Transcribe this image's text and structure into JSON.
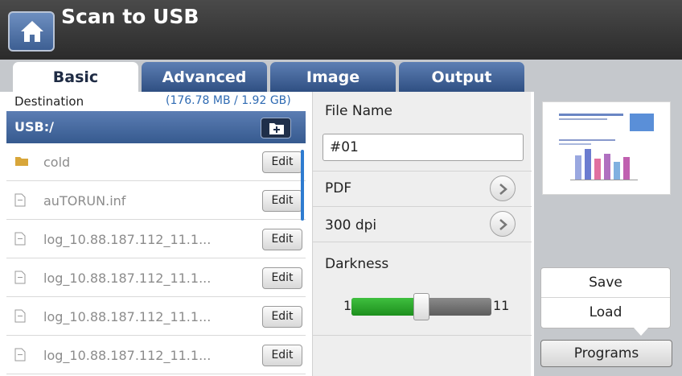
{
  "app": {
    "title": "Scan to USB"
  },
  "tabs": [
    {
      "label": "Basic",
      "active": true
    },
    {
      "label": "Advanced",
      "active": false
    },
    {
      "label": "Image",
      "active": false
    },
    {
      "label": "Output",
      "active": false
    }
  ],
  "destination": {
    "label": "Destination",
    "size": "(176.78 MB / 1.92 GB)",
    "path": "USB:/"
  },
  "files": [
    {
      "name": "cold",
      "type": "folder",
      "edit_label": "Edit"
    },
    {
      "name": "auTORUN.inf",
      "type": "file",
      "edit_label": "Edit"
    },
    {
      "name": "log_10.88.187.112_11.1...",
      "type": "file",
      "edit_label": "Edit"
    },
    {
      "name": "log_10.88.187.112_11.1...",
      "type": "file",
      "edit_label": "Edit"
    },
    {
      "name": "log_10.88.187.112_11.1...",
      "type": "file",
      "edit_label": "Edit"
    },
    {
      "name": "log_10.88.187.112_11.1...",
      "type": "file",
      "edit_label": "Edit"
    }
  ],
  "options": {
    "file_name_label": "File Name",
    "file_name_value": "#01",
    "format": "PDF",
    "resolution": "300 dpi",
    "darkness_label": "Darkness",
    "darkness_min": "1",
    "darkness_max": "11",
    "darkness_value": 6
  },
  "programs": {
    "save_label": "Save",
    "load_label": "Load",
    "programs_label": "Programs"
  },
  "colors": {
    "accent_blue": "#365a8f",
    "slider_green": "#2aa52a",
    "link_blue": "#2f6bb3"
  },
  "icons": {
    "home": "home-icon",
    "add_folder": "add-folder-icon",
    "folder": "folder-icon",
    "file": "file-icon",
    "chevron": "chevron-right-icon"
  }
}
